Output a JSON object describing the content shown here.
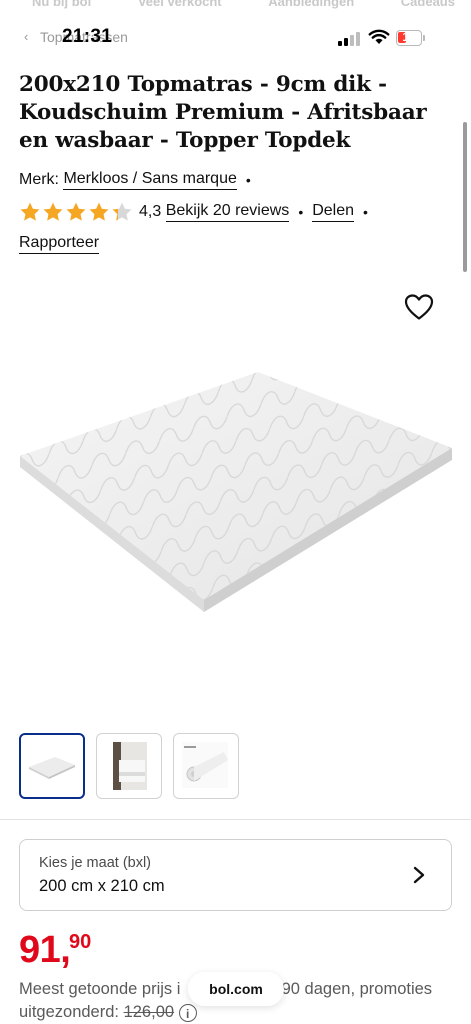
{
  "top_nav": [
    "Nu bij bol",
    "Veel verkocht",
    "Aanbiedingen",
    "Cadeaus"
  ],
  "status_bar": {
    "time": "21:31",
    "battery": "10",
    "back_label": "Topmatrassen"
  },
  "product": {
    "title": "200x210 Topmatras - 9cm dik - Koudschuim Premium - Afritsbaar en wasbaar - Topper Topdek",
    "brand_label": "Merk:",
    "brand": "Merkloos / Sans marque",
    "rating_value": 4.3,
    "rating": "4,3",
    "reviews_link": "Bekijk 20 reviews",
    "share_link": "Delen",
    "report_link": "Rapporteer"
  },
  "size_selector": {
    "label": "Kies je maat (bxl)",
    "value": "200 cm x 210 cm"
  },
  "price": {
    "euros": "91,",
    "cents": "90"
  },
  "disclaimer": {
    "line1a": "Meest getoonde prijs i",
    "line1b": "90 dagen, promoties",
    "line2a": "uitgezonderd: ",
    "old_price": "126,00",
    "info": "i"
  },
  "url_pill": "bol.com",
  "colors": {
    "price_red": "#e0081b",
    "star_yellow": "#f5a623",
    "selected_border": "#0a2f8a"
  }
}
